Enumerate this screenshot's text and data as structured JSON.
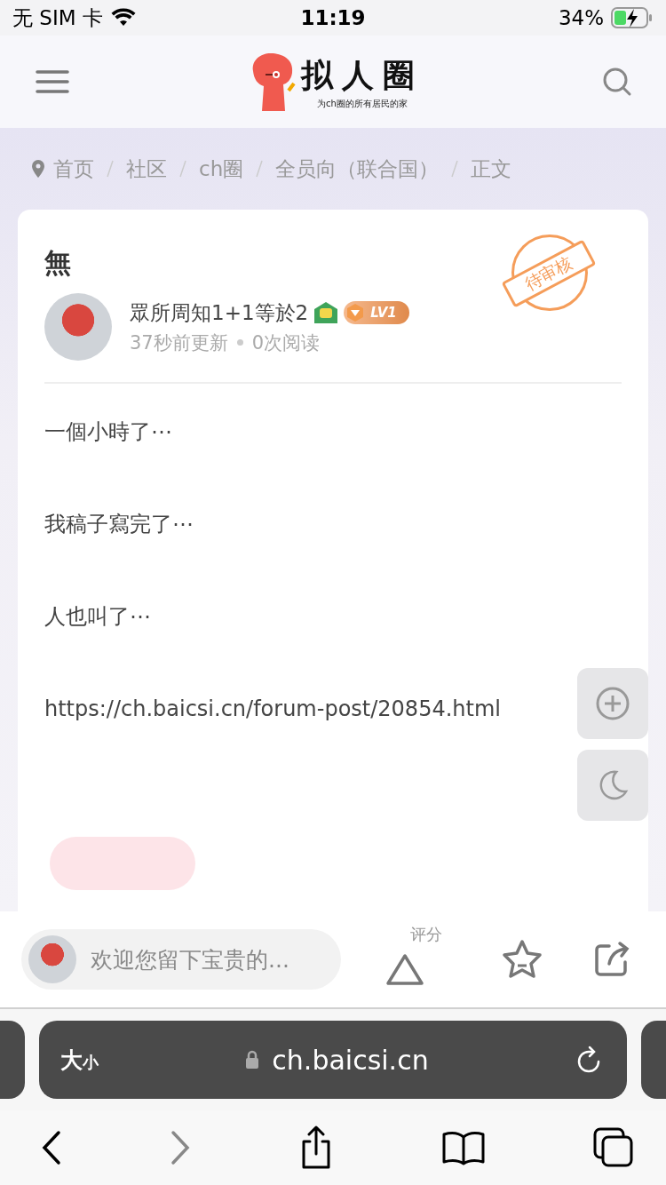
{
  "status_bar": {
    "carrier": "无 SIM 卡",
    "time": "11:19",
    "battery": "34%"
  },
  "header": {
    "logo_title": "拟人圈",
    "logo_subtitle": "为ch圈的所有居民的家"
  },
  "breadcrumb": [
    "首页",
    "社区",
    "ch圈",
    "全员向（联合国）",
    "正文"
  ],
  "post": {
    "title": "無",
    "stamp": "待审核",
    "author": "眾所周知1+1等於2",
    "level_badge": "LV1",
    "updated": "37秒前更新",
    "views": "0次阅读",
    "paragraphs": [
      "一個小時了⋯",
      "我稿子寫完了⋯",
      "人也叫了⋯",
      "https://ch.baicsi.cn/forum-post/20854.html"
    ]
  },
  "comment_bar": {
    "placeholder": "欢迎您留下宝贵的...",
    "rating_label": "评分"
  },
  "safari": {
    "text_size_large": "大",
    "text_size_small": "小",
    "url": "ch.baicsi.cn",
    "forward_disabled": true
  }
}
